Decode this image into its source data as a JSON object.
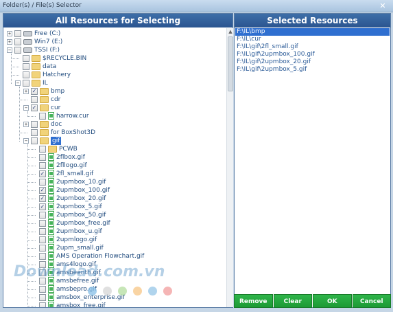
{
  "window": {
    "title": "Folder(s) / File(s) Selector",
    "close_label": "✕"
  },
  "left_panel": {
    "title": "All Resources for Selecting"
  },
  "right_panel": {
    "title": "Selected Resources"
  },
  "tree": [
    {
      "label": "Free (C:)",
      "toggle": "+",
      "checked": false,
      "icon": "drive",
      "depth": 0
    },
    {
      "label": "Win7 (E:)",
      "toggle": "+",
      "checked": false,
      "icon": "drive",
      "depth": 0
    },
    {
      "label": "TSSI (F:)",
      "toggle": "−",
      "checked": false,
      "icon": "drive",
      "depth": 0
    },
    {
      "label": "$RECYCLE.BIN",
      "toggle": "",
      "checked": false,
      "icon": "folder",
      "depth": 1
    },
    {
      "label": "data",
      "toggle": "",
      "checked": false,
      "icon": "folder",
      "depth": 1
    },
    {
      "label": "Hatchery",
      "toggle": "",
      "checked": false,
      "icon": "folder",
      "depth": 1
    },
    {
      "label": "IL",
      "toggle": "−",
      "checked": false,
      "icon": "folder",
      "depth": 1
    },
    {
      "label": "bmp",
      "toggle": "+",
      "checked": true,
      "icon": "folder",
      "depth": 2
    },
    {
      "label": "cdr",
      "toggle": "",
      "checked": false,
      "icon": "folder",
      "depth": 2
    },
    {
      "label": "cur",
      "toggle": "−",
      "checked": true,
      "icon": "folder",
      "depth": 2
    },
    {
      "label": "harrow.cur",
      "toggle": "",
      "checked": false,
      "icon": "file",
      "depth": 3
    },
    {
      "label": "doc",
      "toggle": "+",
      "checked": false,
      "icon": "folder",
      "depth": 2
    },
    {
      "label": "for BoxShot3D",
      "toggle": "",
      "checked": false,
      "icon": "folder",
      "depth": 2
    },
    {
      "label": "gif",
      "toggle": "−",
      "checked": false,
      "icon": "folder",
      "depth": 2,
      "selected": true
    },
    {
      "label": "PCWB",
      "toggle": "",
      "checked": false,
      "icon": "folder",
      "depth": 3
    },
    {
      "label": "2flbox.gif",
      "toggle": "",
      "checked": false,
      "icon": "file",
      "depth": 3
    },
    {
      "label": "2fllogo.gif",
      "toggle": "",
      "checked": false,
      "icon": "file",
      "depth": 3
    },
    {
      "label": "2fl_small.gif",
      "toggle": "",
      "checked": true,
      "icon": "file",
      "depth": 3
    },
    {
      "label": "2upmbox_10.gif",
      "toggle": "",
      "checked": false,
      "icon": "file",
      "depth": 3
    },
    {
      "label": "2upmbox_100.gif",
      "toggle": "",
      "checked": true,
      "icon": "file",
      "depth": 3
    },
    {
      "label": "2upmbox_20.gif",
      "toggle": "",
      "checked": true,
      "icon": "file",
      "depth": 3
    },
    {
      "label": "2upmbox_5.gif",
      "toggle": "",
      "checked": true,
      "icon": "file",
      "depth": 3
    },
    {
      "label": "2upmbox_50.gif",
      "toggle": "",
      "checked": false,
      "icon": "file",
      "depth": 3
    },
    {
      "label": "2upmbox_free.gif",
      "toggle": "",
      "checked": false,
      "icon": "file",
      "depth": 3
    },
    {
      "label": "2upmbox_u.gif",
      "toggle": "",
      "checked": false,
      "icon": "file",
      "depth": 3
    },
    {
      "label": "2upmlogo.gif",
      "toggle": "",
      "checked": false,
      "icon": "file",
      "depth": 3
    },
    {
      "label": "2upm_small.gif",
      "toggle": "",
      "checked": false,
      "icon": "file",
      "depth": 3
    },
    {
      "label": "AMS Operation Flowchart.gif",
      "toggle": "",
      "checked": false,
      "icon": "file",
      "depth": 3
    },
    {
      "label": "ams4logo.gif",
      "toggle": "",
      "checked": false,
      "icon": "file",
      "depth": 3
    },
    {
      "label": "amsbeenth.gif",
      "toggle": "",
      "checked": false,
      "icon": "file",
      "depth": 3
    },
    {
      "label": "amsbefree.gif",
      "toggle": "",
      "checked": false,
      "icon": "file",
      "depth": 3
    },
    {
      "label": "amsbepro.gif",
      "toggle": "",
      "checked": false,
      "icon": "file",
      "depth": 3
    },
    {
      "label": "amsbox_enterprise.gif",
      "toggle": "",
      "checked": false,
      "icon": "file",
      "depth": 3
    },
    {
      "label": "amsbox_free.gif",
      "toggle": "",
      "checked": false,
      "icon": "file",
      "depth": 3
    }
  ],
  "selected_items": [
    {
      "path": "F:\\IL\\bmp",
      "active": true
    },
    {
      "path": "F:\\IL\\cur",
      "active": false
    },
    {
      "path": "F:\\IL\\gif\\2fl_small.gif",
      "active": false
    },
    {
      "path": "F:\\IL\\gif\\2upmbox_100.gif",
      "active": false
    },
    {
      "path": "F:\\IL\\gif\\2upmbox_20.gif",
      "active": false
    },
    {
      "path": "F:\\IL\\gif\\2upmbox_5.gif",
      "active": false
    }
  ],
  "buttons": {
    "remove": "Remove",
    "clear": "Clear",
    "ok": "OK",
    "cancel": "Cancel"
  },
  "watermark": {
    "text": "Download.com.vn",
    "dot_colors": [
      "#8fc3e8",
      "#d8d8d8",
      "#b9e0a5",
      "#f7c98c",
      "#9cc9e9",
      "#f3a3a3"
    ]
  },
  "colors": {
    "header": "#2f5e9b",
    "button": "#22a33d",
    "selection": "#2f6fd0"
  }
}
